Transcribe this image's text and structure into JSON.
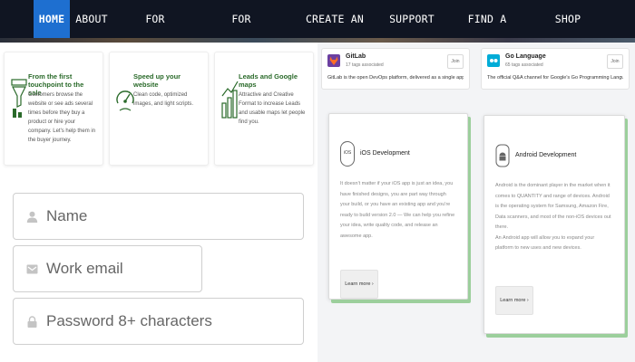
{
  "nav": {
    "items": [
      {
        "label": "HOME",
        "active": true
      },
      {
        "label": "ABOUT"
      },
      {
        "label": "FOR BOOKSTORES"
      },
      {
        "label": "FOR PUBLISHERS"
      },
      {
        "label": "CREATE AN ACCOUNT"
      },
      {
        "label": "SUPPORT"
      },
      {
        "label": "FIND A BOOKSTORE"
      },
      {
        "label": "SHOP LOCAL"
      }
    ]
  },
  "features": [
    {
      "title": "From the first touchpoint to the sale",
      "desc": "Customers browse the website or see ads several times before they buy a product or hire your company. Let's help them in the buyer journey.",
      "icon": "funnel-icon"
    },
    {
      "title": "Speed up your website",
      "desc": "Clean code, optimized images, and light scripts.",
      "icon": "speedometer-icon"
    },
    {
      "title": "Leads and Google maps",
      "desc": "Attractive and Creative Format to increase Leads and usable maps let people find you.",
      "icon": "bar-chart-icon"
    }
  ],
  "form": {
    "name_placeholder": "Name",
    "email_placeholder": "Work email",
    "password_placeholder": "Password 8+ characters"
  },
  "tags": [
    {
      "name": "GitLab",
      "count": "17 tags associated",
      "join": "Join",
      "desc": "GitLab is the open DevOps platform, delivered as a single application. Our open source collaboration is a great place to sha...",
      "color": "#e24329"
    },
    {
      "name": "Go Language",
      "count": "65 tags associated",
      "join": "Join",
      "desc": "The official Q&A channel for Google's Go Programming Language.",
      "color": "#00acd7"
    }
  ],
  "dev_cards": [
    {
      "title": "iOS Development",
      "desc": "It doesn't matter if your iOS app is just an idea, you have finished designs, you are part way through your build, or you have an existing app and you're ready to build version 2.0 — We can help you refine your idea, write quality code, and release an awesome app.",
      "button": "Learn more ›",
      "icon": "ios-icon"
    },
    {
      "title": "Android Development",
      "desc": "Android is the dominant player in the market when it comes to QUANTITY and range of devices. Android is the operating system for Samsung, Amazon Fire, Data scanners, and most of the non-iOS devices out there.\nAn Android app will allow you to expand your platform to new uses and new devices.",
      "button": "Learn more ›",
      "icon": "android-icon"
    }
  ],
  "colors": {
    "nav_bg": "#101522",
    "nav_active": "#1e6fd0",
    "card_shadow": "#9ccf9c",
    "feature_title": "#2a6a2a"
  }
}
